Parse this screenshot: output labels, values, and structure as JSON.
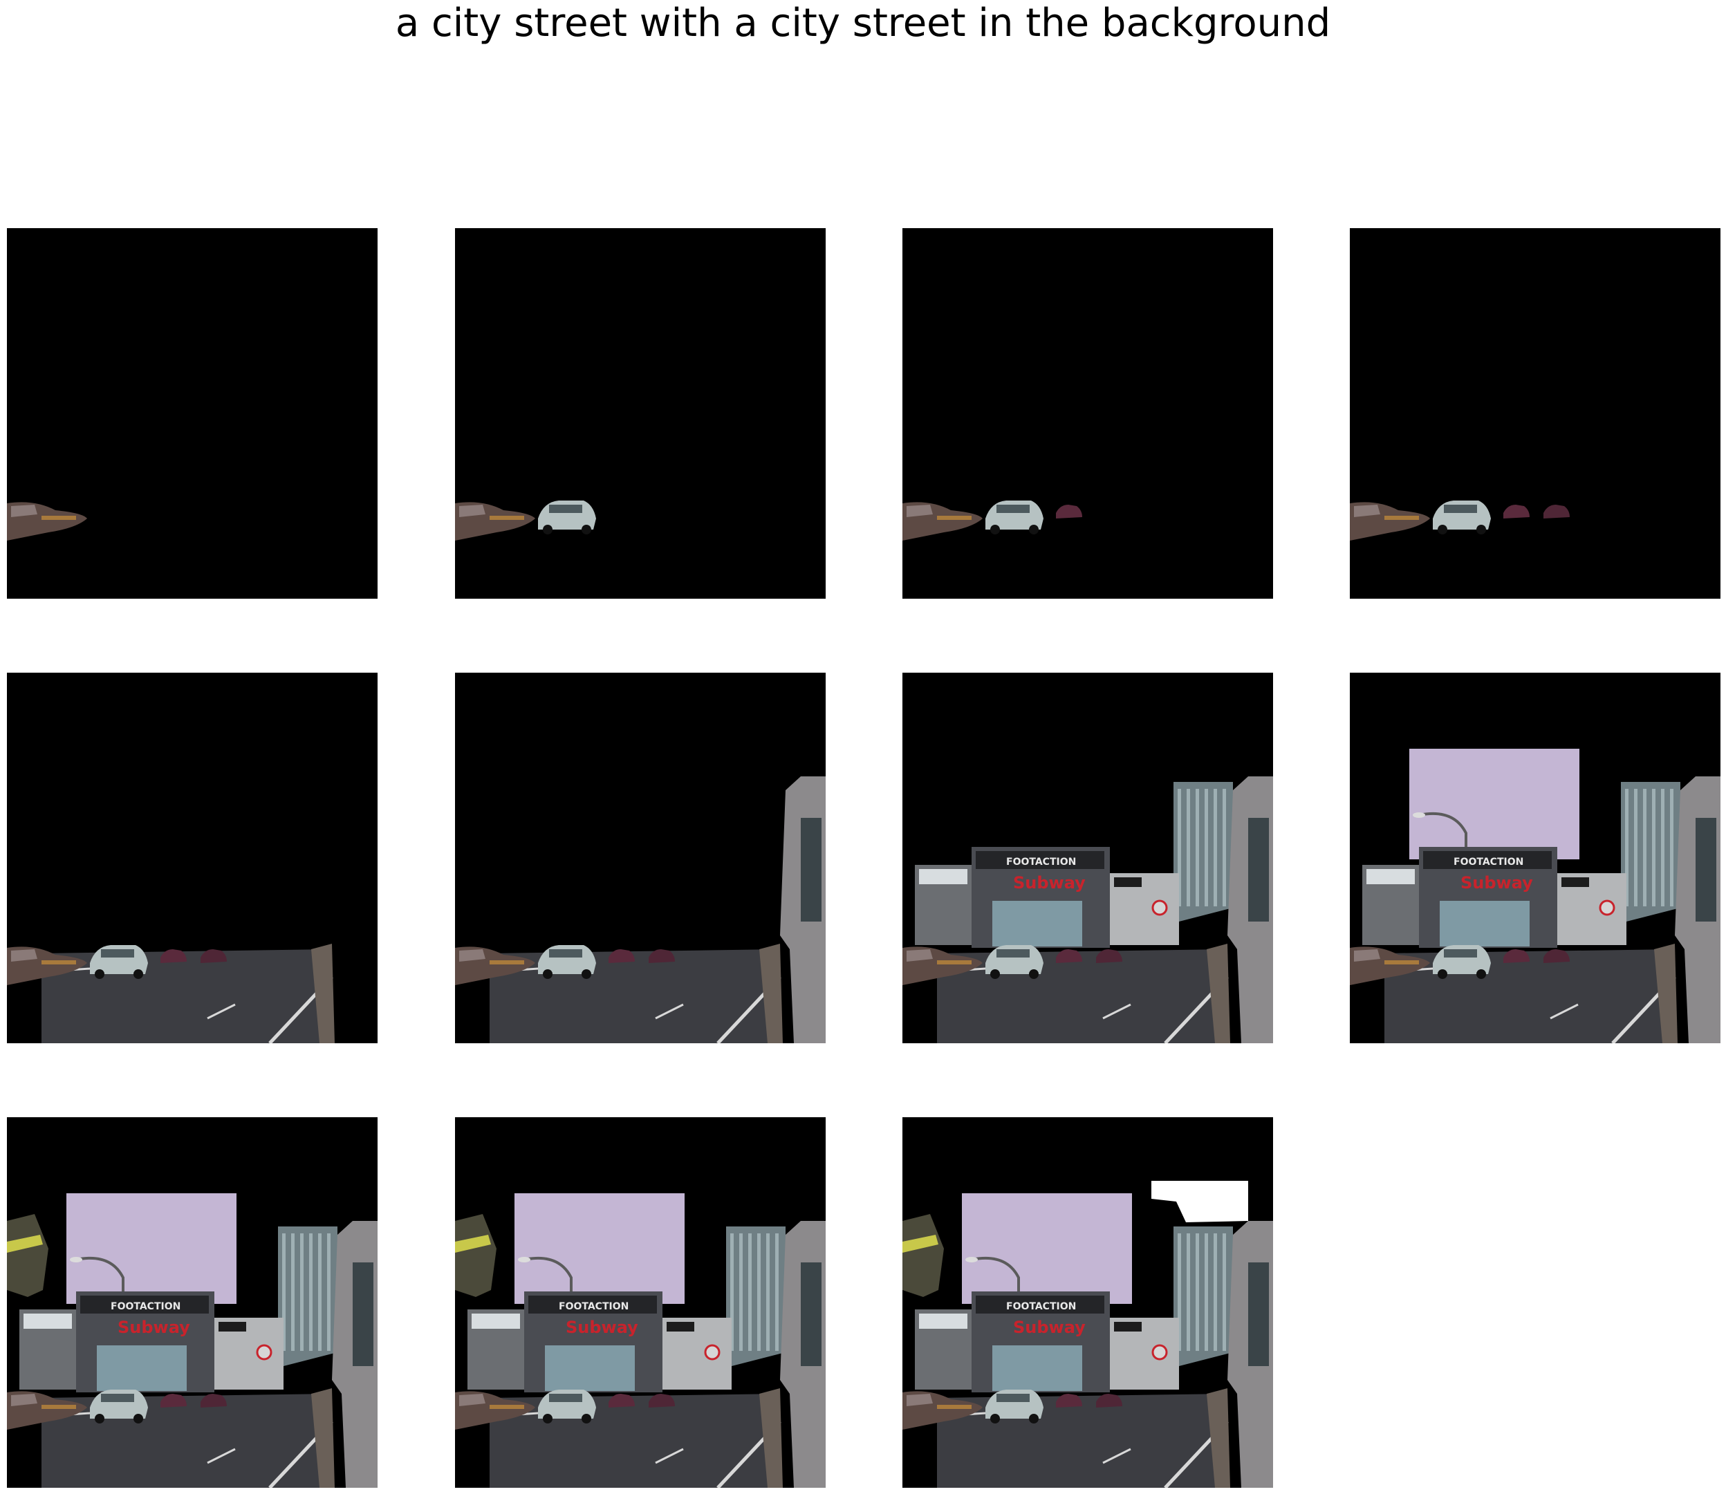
{
  "figure": {
    "title": "a city street with a city street in the background"
  },
  "panels": [
    {
      "index": 1,
      "layers": [
        "car-left"
      ]
    },
    {
      "index": 2,
      "layers": [
        "car-left",
        "car-silver"
      ]
    },
    {
      "index": 3,
      "layers": [
        "car-left",
        "car-silver",
        "car-small-1"
      ]
    },
    {
      "index": 4,
      "layers": [
        "car-left",
        "car-silver",
        "car-small-1",
        "car-small-2"
      ]
    },
    {
      "index": 5,
      "layers": [
        "car-left",
        "car-silver",
        "car-small-1",
        "car-small-2",
        "road"
      ]
    },
    {
      "index": 6,
      "layers": [
        "car-left",
        "car-silver",
        "car-small-1",
        "car-small-2",
        "road",
        "building-right-edge"
      ]
    },
    {
      "index": 7,
      "layers": [
        "car-left",
        "car-silver",
        "car-small-1",
        "car-small-2",
        "road",
        "building-right-edge",
        "storefronts",
        "tower-right"
      ]
    },
    {
      "index": 8,
      "layers": [
        "car-left",
        "car-silver",
        "car-small-1",
        "car-small-2",
        "road",
        "building-right-edge",
        "storefronts",
        "tower-right",
        "sky",
        "streetlight"
      ]
    },
    {
      "index": 9,
      "layers": [
        "car-left",
        "car-silver",
        "car-small-1",
        "car-small-2",
        "road",
        "building-right-edge",
        "storefronts",
        "tower-right",
        "sky",
        "streetlight",
        "building-left"
      ]
    },
    {
      "index": 10,
      "layers": [
        "car-left",
        "car-silver",
        "car-small-1",
        "car-small-2",
        "road",
        "building-right-edge",
        "storefronts",
        "tower-right",
        "sky",
        "streetlight",
        "building-left"
      ]
    },
    {
      "index": 11,
      "layers": [
        "car-left",
        "car-silver",
        "car-small-1",
        "car-small-2",
        "road",
        "building-right-edge",
        "storefronts",
        "tower-right",
        "sky",
        "streetlight",
        "building-left",
        "white-sky-patch"
      ]
    }
  ],
  "scene_text": {
    "store_sign": "FOOTACTION",
    "subway_sign": "Subway"
  },
  "colors": {
    "background": "#ffffff",
    "panel_mask": "#000000",
    "sky": "#c4b6d4",
    "road": "#3c3d42",
    "subway_red": "#c8232c"
  }
}
